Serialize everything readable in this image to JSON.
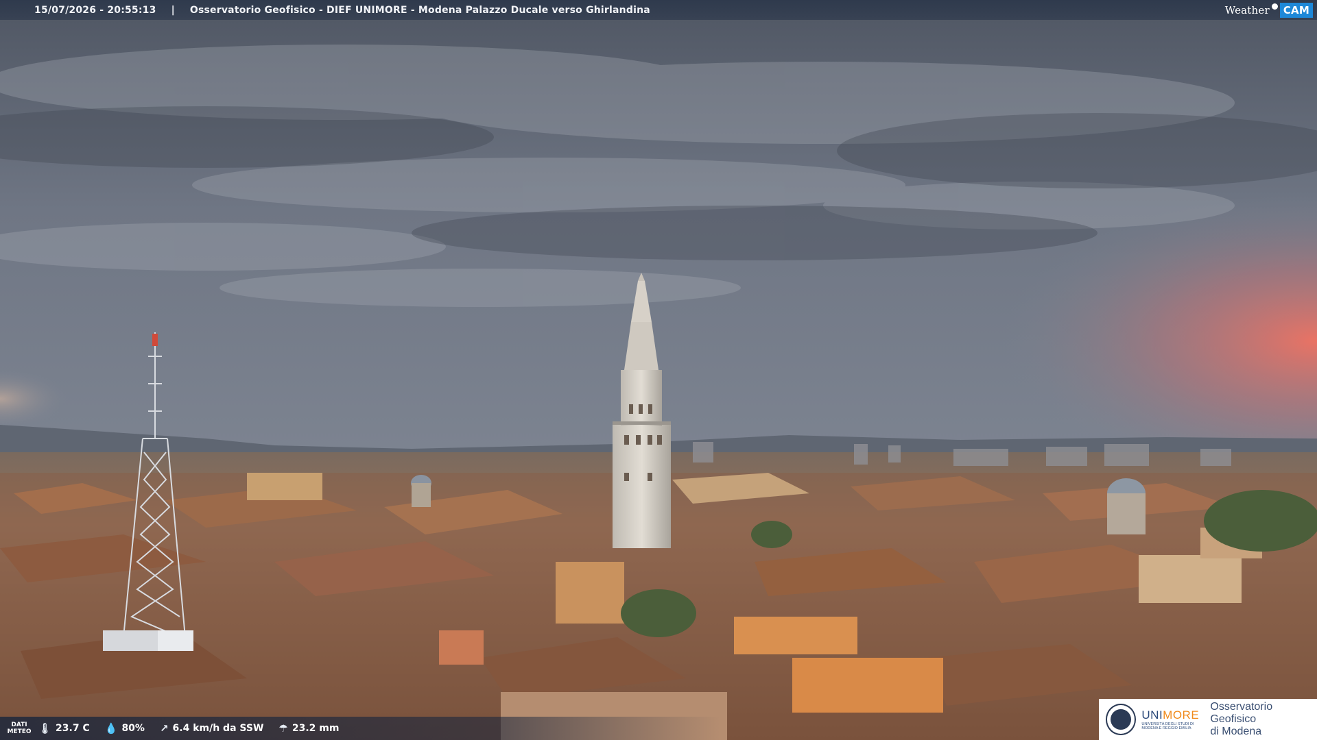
{
  "topbar": {
    "timestamp": "15/07/2026 - 20:55:13",
    "separator": "|",
    "title": "Osservatorio Geofisico - DIEF UNIMORE - Modena Palazzo Ducale verso Ghirlandina",
    "brand_weather": "Weather",
    "brand_cam": "CAM"
  },
  "meteo": {
    "label_line1": "DATI",
    "label_line2": "METEO",
    "temperature": "23.7 C",
    "humidity": "80%",
    "wind": "6.4 km/h da SSW",
    "rain": "23.2 mm",
    "icons": [
      "thermometer-icon",
      "drop-icon",
      "wind-icon",
      "rain-icon"
    ]
  },
  "logo": {
    "uni_part1": "UNI",
    "uni_part2": "MORE",
    "uni_subtitle": "UNIVERSITÀ DEGLI STUDI DI MODENA E REGGIO EMILIA",
    "obs_line1": "Osservatorio Geofisico",
    "obs_line2": "di Modena"
  },
  "colors": {
    "sky_top": "#5a6170",
    "sky_mid": "#727986",
    "sunset_glow": "#e07068",
    "roofs": "#9a6a4e",
    "cam_brand": "#1e88d8",
    "unimore_blue": "#2b4a7a",
    "unimore_orange": "#f08a1c"
  }
}
